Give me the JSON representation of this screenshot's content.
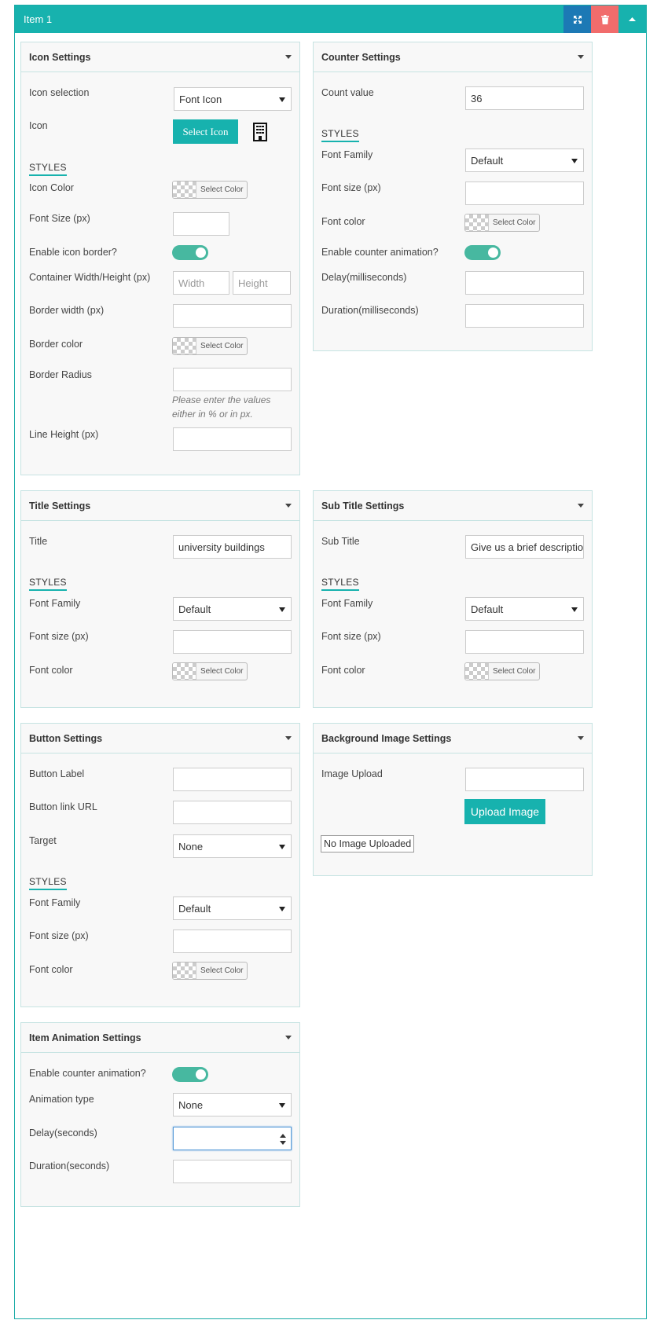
{
  "item": {
    "title": "Item 1"
  },
  "header_icons": {
    "expand": "expand-icon",
    "delete": "trash-icon",
    "collapse": "caret-up-icon"
  },
  "icon_settings": {
    "title": "Icon Settings",
    "icon_selection_label": "Icon selection",
    "icon_selection_value": "Font Icon",
    "icon_label": "Icon",
    "select_icon_button": "Select Icon",
    "selected_icon": "building-icon",
    "styles": "STYLES",
    "icon_color_label": "Icon Color",
    "select_color": "Select Color",
    "font_size_label": "Font Size (px)",
    "enable_border_label": "Enable icon border?",
    "container_label": "Container Width/Height (px)",
    "width_placeholder": "Width",
    "height_placeholder": "Height",
    "border_width_label": "Border width (px)",
    "border_color_label": "Border color",
    "border_radius_label": "Border Radius",
    "border_radius_note": "Please enter the values either in % or in px.",
    "line_height_label": "Line Height (px)"
  },
  "counter_settings": {
    "title": "Counter Settings",
    "count_value_label": "Count value",
    "count_value": "36",
    "styles": "STYLES",
    "font_family_label": "Font Family",
    "font_family_value": "Default",
    "font_size_label": "Font size (px)",
    "font_color_label": "Font color",
    "select_color": "Select Color",
    "enable_animation_label": "Enable counter animation?",
    "delay_label": "Delay(milliseconds)",
    "duration_label": "Duration(milliseconds)"
  },
  "title_settings": {
    "title": "Title Settings",
    "title_label": "Title",
    "title_value": "university buildings",
    "styles": "STYLES",
    "font_family_label": "Font Family",
    "font_family_value": "Default",
    "font_size_label": "Font size (px)",
    "font_color_label": "Font color",
    "select_color": "Select Color"
  },
  "subtitle_settings": {
    "title": "Sub Title Settings",
    "subtitle_label": "Sub Title",
    "subtitle_value": "Give us a brief descriptio",
    "styles": "STYLES",
    "font_family_label": "Font Family",
    "font_family_value": "Default",
    "font_size_label": "Font size (px)",
    "font_color_label": "Font color",
    "select_color": "Select Color"
  },
  "button_settings": {
    "title": "Button Settings",
    "button_label_label": "Button Label",
    "link_url_label": "Button link URL",
    "target_label": "Target",
    "target_value": "None",
    "styles": "STYLES",
    "font_family_label": "Font Family",
    "font_family_value": "Default",
    "font_size_label": "Font size (px)",
    "font_color_label": "Font color",
    "select_color": "Select Color"
  },
  "background_settings": {
    "title": "Background Image Settings",
    "image_upload_label": "Image Upload",
    "upload_button": "Upload Image",
    "no_image": "No Image Uploaded"
  },
  "animation_settings": {
    "title": "Item Animation Settings",
    "enable_animation_label": "Enable counter animation?",
    "animation_type_label": "Animation type",
    "animation_type_value": "None",
    "delay_label": "Delay(seconds)",
    "duration_label": "Duration(seconds)"
  },
  "colors": {
    "accent": "#17b2ae",
    "expand_button": "#1c79b5",
    "delete_button": "#f16c6c",
    "toggle_on": "#47b8a0"
  }
}
